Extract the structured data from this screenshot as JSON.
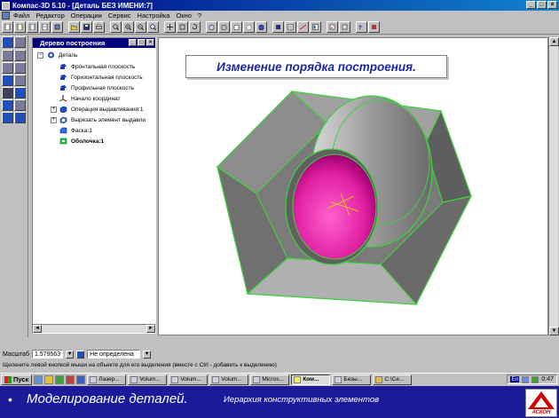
{
  "window": {
    "title": "Компас-3D 5.10 - [Деталь БЕЗ ИМЕНИ:7]",
    "controls": [
      "_",
      "□",
      "×"
    ]
  },
  "menu": {
    "items": [
      "Файл",
      "Редактор",
      "Операции",
      "Сервис",
      "Настройка",
      "Окно",
      "?"
    ]
  },
  "tree_panel": {
    "title": "Дерево построения",
    "root": "Деталь",
    "items": [
      {
        "label": "Фронтальная плоскость",
        "icon": "plane-icon"
      },
      {
        "label": "Горизонтальная плоскость",
        "icon": "plane-icon"
      },
      {
        "label": "Профильная плоскость",
        "icon": "plane-icon"
      },
      {
        "label": "Начало координат",
        "icon": "origin-icon"
      },
      {
        "label": "Операция выдавливания:1",
        "icon": "extrude-icon"
      },
      {
        "label": "Вырезать элемент выдавли",
        "icon": "cut-extrude-icon"
      },
      {
        "label": "Фаска:1",
        "icon": "chamfer-icon"
      },
      {
        "label": "Оболочка:1",
        "icon": "shell-icon"
      }
    ]
  },
  "canvas": {
    "slide_title": "Изменение порядка построения."
  },
  "scale_bar": {
    "label": "Масштаб",
    "value": "1.579563",
    "state": "Не определена"
  },
  "status": {
    "hint": "Щелкните левой кнопкой мыши на объекте для его выделения (вместе с Ctrl - добавить к выделению)"
  },
  "taskbar": {
    "start": "Пуск",
    "tasks": [
      "Лазер...",
      "Volum...",
      "Volum...",
      "Volum...",
      "Micros...",
      "Ком...",
      "Безы...",
      "C:\\Ce..."
    ],
    "lang": "En",
    "clock": "0:47"
  },
  "caption": {
    "bullet": "•",
    "main": "Моделирование деталей.",
    "sub": "Иерархия конструктивных элементов"
  },
  "logo": {
    "text": "АСКОН"
  },
  "colors": {
    "titlebar": "#000080",
    "band": "#1a1a9a",
    "slide_title_text": "#1a2a9a",
    "model_face": "#8a8a8a",
    "model_edges": "#40d040",
    "inner_bore": "#e020a0"
  }
}
